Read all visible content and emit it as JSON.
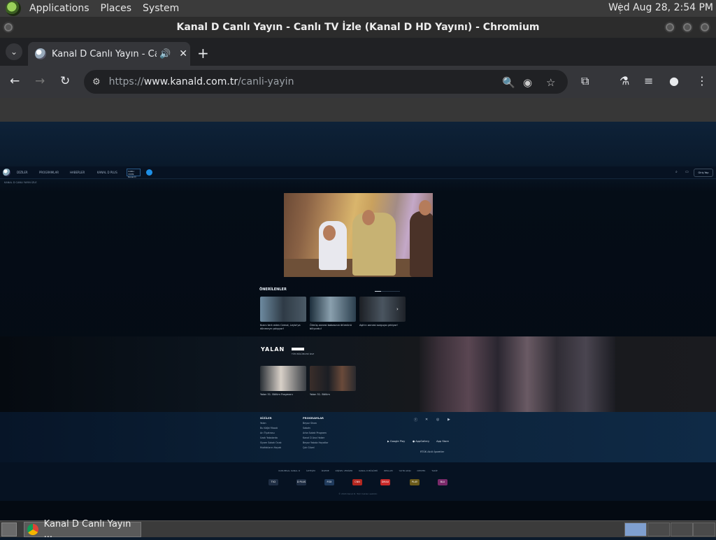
{
  "top_panel": {
    "menus": [
      "Applications",
      "Places",
      "System"
    ],
    "clock": "Wed Aug 28,  2:54 PM"
  },
  "window": {
    "title": "Kanal D Canlı Yayın - Canlı TV İzle (Kanal D HD Yayını) - Chromium"
  },
  "tab": {
    "title": "Kanal D Canlı Yayın - Canlı",
    "audio_icon": "speaker-icon",
    "close": "✕"
  },
  "toolbar": {
    "url_scheme": "https://",
    "url_host": "www.kanald.com.tr",
    "url_path": "/canli-yayin"
  },
  "site": {
    "nav": [
      "DİZİLER",
      "PROGRAMLAR",
      "HABERLER",
      "KANAL D PLUS"
    ],
    "live_label": "CANLI YAYIN Kanal D",
    "login": "Giriş Yap",
    "breadcrumb": "KANAL D CANLI YAYIN İZLE",
    "recommend_title": "ÖNERİLENLER",
    "recommendations": [
      {
        "caption": "Kızını terk eden Cemal, Leyla'ya dönmeye çalışıyor!"
      },
      {
        "caption": "Ölmüş annesi babasının ölümünü biliyordu!"
      },
      {
        "caption": "Aşk'ın annesi sorguya çekiyor!"
      }
    ],
    "show": {
      "logo": "YALAN",
      "subtitle": "TÜM BÖLÜMLERİ İZLE",
      "episodes": [
        {
          "caption": "Yalan 51. Bölüm Fragmanı"
        },
        {
          "caption": "Yalan 51. Bölüm"
        }
      ]
    },
    "footer": {
      "col1_title": "DİZİLER",
      "col1_links": [
        "Yalan",
        "Bu Kâğıt Masalı",
        "Arı Tiyatrosu",
        "Uzak Yakalarda",
        "Siyam Sokak Ocak",
        "Mutfakların Hayatı"
      ],
      "col2_title": "PROGRAMLAR",
      "col2_links": [
        "Beyaz Show",
        "Sabahı",
        "Arka Sokak Programı",
        "Kanal D Ana Haber",
        "Beyaz Yakala Hayatlar",
        "Çok Güzel"
      ],
      "stores": [
        "Google Play",
        "AppGallery",
        "App Store"
      ],
      "rtuk": "RTÜK Akıllı İşaretler",
      "bottom_links": [
        "KURUMSAL KANAL D",
        "İLETİŞİM",
        "İZLEME",
        "KİŞİSEL VERİLER",
        "KANAL D BÖLÜMÜ",
        "REKLAM",
        "YAYIN AKIŞI",
        "DESTEK",
        "TAKİP"
      ],
      "channels": [
        "TV2",
        "D PLUS",
        "FOX",
        "CNN",
        "DMAX",
        "PLAY",
        "BLU"
      ],
      "copyright": "© 2024 Kanal D. Tüm hakları saklıdır."
    }
  },
  "taskbar": {
    "item_label": "Kanal D Canlı Yayın ..."
  }
}
